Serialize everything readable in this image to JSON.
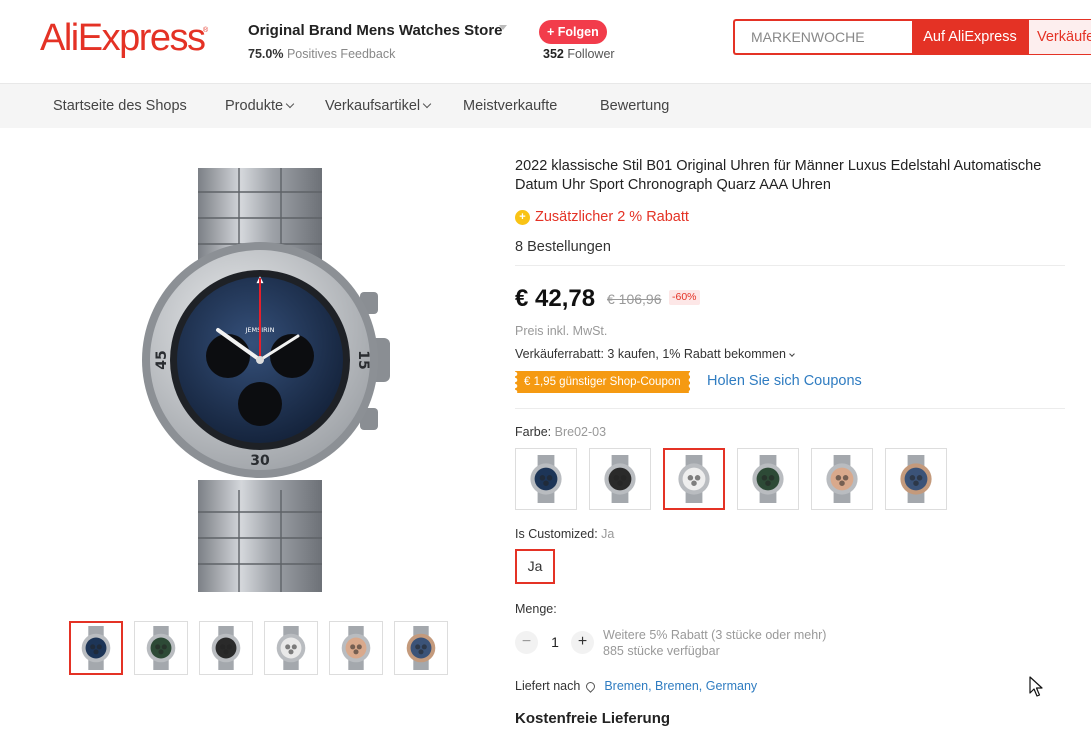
{
  "header": {
    "logo": "AliExpress",
    "logo_tm": "®",
    "store_name": "Original Brand Mens Watches Store",
    "feedback_percent": "75.0%",
    "feedback_label": "Positives Feedback",
    "follow_label": "+ Folgen",
    "followers_count": "352",
    "followers_label": "Follower",
    "search_value": "MARKENWOCHE",
    "search_ali_label": "Auf AliExpress",
    "search_shop_label": "Verkäufe"
  },
  "nav": {
    "items": [
      {
        "label": "Startseite des Shops",
        "dropdown": false
      },
      {
        "label": "Produkte",
        "dropdown": true
      },
      {
        "label": "Verkaufsartikel",
        "dropdown": true
      },
      {
        "label": "Meistverkaufte",
        "dropdown": false
      },
      {
        "label": "Bewertung",
        "dropdown": false
      }
    ]
  },
  "gallery": {
    "brand_on_dial": "JEMSIRIN",
    "bezel_numbers": [
      "45",
      "30",
      "15"
    ],
    "thumbnails": [
      {
        "dial": "#1d3557",
        "case": "#b9bcc0",
        "active": true
      },
      {
        "dial": "#2d4a36",
        "case": "#b9bcc0",
        "active": false
      },
      {
        "dial": "#2a2a2a",
        "case": "#b9bcc0",
        "active": false
      },
      {
        "dial": "#e9e9e9",
        "case": "#b9bcc0",
        "active": false
      },
      {
        "dial": "#d9a98c",
        "case": "#b9bcc0",
        "active": false
      },
      {
        "dial": "#3b5378",
        "case": "#c49a7c",
        "active": false
      }
    ]
  },
  "product": {
    "title": "2022 klassische Stil B01 Original Uhren für Männer Luxus Edelstahl Automatische Datum Uhr Sport Chronograph Quarz AAA Uhren",
    "extra_discount": "Zusätzlicher 2 % Rabatt",
    "orders": "8 Bestellungen",
    "price": "€ 42,78",
    "old_price": "€ 106,96",
    "discount_badge": "-60%",
    "vat_note": "Preis inkl. MwSt.",
    "seller_discount": "Verkäuferrabatt: 3 kaufen, 1% Rabatt bekommen",
    "coupon_tag": "€ 1,95 günstiger Shop-Coupon",
    "get_coupons": "Holen Sie sich Coupons",
    "color_label": "Farbe:",
    "color_value": "Bre02-03",
    "swatches": [
      {
        "dial": "#1d3557",
        "case": "#b9bcc0",
        "active": false
      },
      {
        "dial": "#2a2a2a",
        "case": "#b9bcc0",
        "active": false
      },
      {
        "dial": "#eeeeee",
        "case": "#b9bcc0",
        "active": true
      },
      {
        "dial": "#2d4a36",
        "case": "#b9bcc0",
        "active": false
      },
      {
        "dial": "#d9a98c",
        "case": "#b9bcc0",
        "active": false
      },
      {
        "dial": "#3b5378",
        "case": "#c49a7c",
        "active": false
      }
    ],
    "customized_label": "Is Customized:",
    "customized_value": "Ja",
    "customized_option": "Ja",
    "quantity_label": "Menge:",
    "quantity_minus": "−",
    "quantity_plus": "+",
    "quantity_value": "1",
    "quantity_note_1": "Weitere 5% Rabatt (3 stücke oder mehr)",
    "quantity_note_2": "885 stücke verfügbar",
    "ship_label": "Liefert nach",
    "ship_location": "Bremen, Bremen, Germany",
    "free_shipping": "Kostenfreie Lieferung"
  },
  "colors": {
    "brand_red": "#e43225",
    "follow_red": "#f23c4b",
    "coupon_orange": "#f59a12",
    "link_blue": "#2f7cc1"
  }
}
